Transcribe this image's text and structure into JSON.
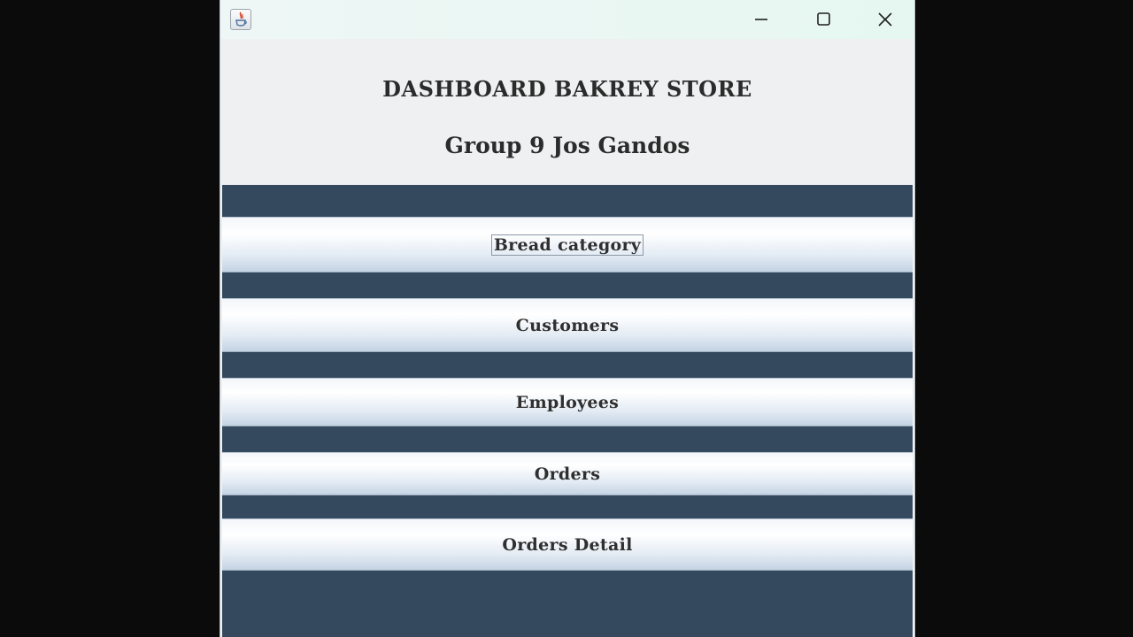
{
  "window": {
    "app_icon": "java-app-icon",
    "controls": {
      "minimize_icon": "minimize-icon",
      "maximize_icon": "maximize-icon",
      "close_icon": "close-icon"
    }
  },
  "header": {
    "title": "DASHBOARD BAKREY STORE",
    "subtitle": "Group 9 Jos Gandos"
  },
  "menu": {
    "items": [
      {
        "label": "Bread category",
        "focused": true
      },
      {
        "label": "Customers"
      },
      {
        "label": "Employees"
      },
      {
        "label": "Orders"
      },
      {
        "label": "Orders Detail"
      }
    ]
  },
  "colors": {
    "panel_background": "#34495e",
    "header_background": "#eef0f1",
    "titlebar_background": "#e6f7f1"
  }
}
